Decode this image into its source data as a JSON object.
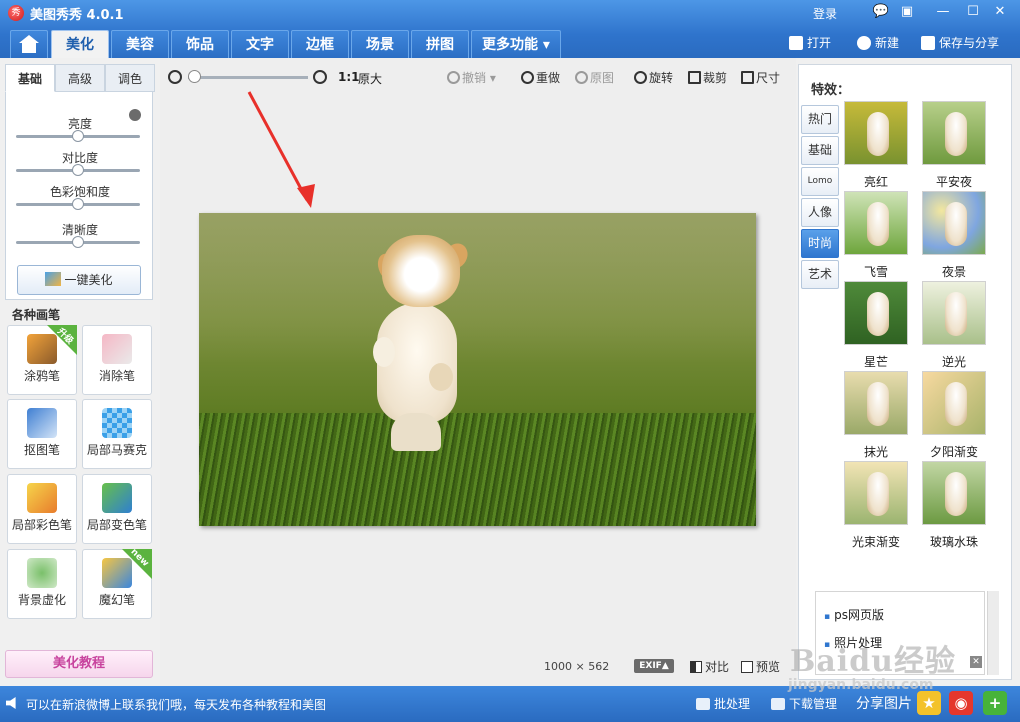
{
  "titlebar": {
    "logo_text": "秀",
    "app_title": "美图秀秀 4.0.1",
    "login": "登录",
    "window_buttons": [
      "💬",
      "▣",
      "—",
      "☐",
      "✕"
    ]
  },
  "main_tabs": [
    "美化",
    "美容",
    "饰品",
    "文字",
    "边框",
    "场景",
    "拼图",
    "更多功能 ▾"
  ],
  "top_actions": {
    "open": "打开",
    "new": "新建",
    "save_share": "保存与分享"
  },
  "left_panel": {
    "sub_tabs": [
      "基础",
      "高级",
      "调色"
    ],
    "sliders": [
      {
        "label": "亮度",
        "value": 0.5
      },
      {
        "label": "对比度",
        "value": 0.5
      },
      {
        "label": "色彩饱和度",
        "value": 0.5
      },
      {
        "label": "清晰度",
        "value": 0.5
      }
    ],
    "one_click": "一键美化",
    "brush_title": "各种画笔",
    "brushes": [
      {
        "label": "涂鸦笔",
        "badge": "升级"
      },
      {
        "label": "消除笔",
        "badge": ""
      },
      {
        "label": "抠图笔",
        "badge": ""
      },
      {
        "label": "局部马赛克",
        "badge": ""
      },
      {
        "label": "局部彩色笔",
        "badge": ""
      },
      {
        "label": "局部变色笔",
        "badge": ""
      },
      {
        "label": "背景虚化",
        "badge": ""
      },
      {
        "label": "魔幻笔",
        "badge": "new"
      }
    ],
    "tutorial": "美化教程"
  },
  "canvas": {
    "zoom_one_to_one": "1:1",
    "zoom_original": "原大",
    "zoom_level": 0.05,
    "tools": {
      "undo": "撤销",
      "redo": "重做",
      "original": "原图",
      "rotate": "旋转",
      "crop": "裁剪",
      "size": "尺寸"
    },
    "dimensions": "1000 × 562",
    "exif": "EXIF▲",
    "compare": "对比",
    "preview": "预览"
  },
  "right_panel": {
    "title": "特效：",
    "categories": [
      "热门",
      "基础",
      "Lomo",
      "人像",
      "时尚",
      "艺术"
    ],
    "active_category": "时尚",
    "effects": [
      "亮红",
      "平安夜",
      "飞雪",
      "夜景",
      "星芒",
      "逆光",
      "抹光",
      "夕阳渐变",
      "光束渐变",
      "玻璃水珠"
    ],
    "ads": [
      "ps网页版",
      "照片处理"
    ],
    "ad_close": "✕"
  },
  "statusbar": {
    "message": "可以在新浪微博上联系我们哦，每天发布各种教程和美图",
    "batch": "批处理",
    "download_manager": "下载管理",
    "share_photo": "分享图片"
  },
  "watermark": {
    "text": "Baidu经验",
    "url": "jingyan.baidu.com"
  },
  "colors": {
    "titlebar": "#2f74cc",
    "accent_green": "#5bb33f",
    "tutorial_pink": "#c8449e"
  }
}
